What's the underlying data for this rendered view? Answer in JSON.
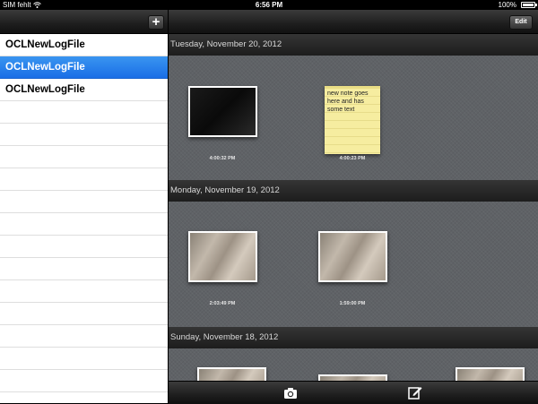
{
  "status_bar": {
    "carrier": "SIM fehlt",
    "time": "6:56 PM",
    "battery": "100%"
  },
  "sidebar": {
    "add_icon": "+",
    "items": [
      {
        "label": "OCLNewLogFile",
        "selected": false
      },
      {
        "label": "OCLNewLogFile",
        "selected": true
      },
      {
        "label": "OCLNewLogFile",
        "selected": false
      }
    ]
  },
  "detail": {
    "edit_label": "Edit",
    "sections": [
      {
        "header": "Tuesday, November 20, 2012",
        "entries": [
          {
            "kind": "photo",
            "style": "dark",
            "time": "4:00:32 PM"
          },
          {
            "kind": "note",
            "text": "new note goes here and has some text",
            "time": "4:00:23 PM"
          }
        ]
      },
      {
        "header": "Monday, November 19, 2012",
        "entries": [
          {
            "kind": "photo",
            "style": "blur",
            "time": "2:03:49 PM"
          },
          {
            "kind": "photo",
            "style": "blur",
            "time": "1:59:00 PM"
          }
        ]
      },
      {
        "header": "Sunday, November 18, 2012",
        "entries": []
      }
    ]
  },
  "bottom_toolbar": {
    "left_icon": "camera-icon",
    "right_icon": "compose-icon"
  },
  "colors": {
    "selection": "#1a6ee6",
    "toolbar": "#1e1e1e",
    "pane_background": "#5f6266",
    "note_yellow": "#f6eda0"
  }
}
